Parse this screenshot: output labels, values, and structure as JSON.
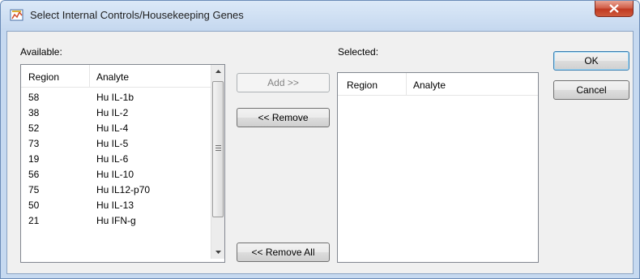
{
  "window": {
    "title": "Select Internal Controls/Housekeeping Genes"
  },
  "available": {
    "label": "Available:",
    "columns": [
      "Region",
      "Analyte"
    ],
    "rows": [
      {
        "region": "58",
        "analyte": "Hu IL-1b"
      },
      {
        "region": "38",
        "analyte": "Hu IL-2"
      },
      {
        "region": "52",
        "analyte": "Hu IL-4"
      },
      {
        "region": "73",
        "analyte": "Hu IL-5"
      },
      {
        "region": "19",
        "analyte": "Hu IL-6"
      },
      {
        "region": "56",
        "analyte": "Hu IL-10"
      },
      {
        "region": "75",
        "analyte": "Hu IL12-p70"
      },
      {
        "region": "50",
        "analyte": "Hu IL-13"
      },
      {
        "region": "21",
        "analyte": "Hu IFN-g"
      }
    ]
  },
  "selected": {
    "label": "Selected:",
    "columns": [
      "Region",
      "Analyte"
    ]
  },
  "buttons": {
    "add": "Add >>",
    "remove": "<< Remove",
    "remove_all": "<< Remove All",
    "ok": "OK",
    "cancel": "Cancel"
  }
}
